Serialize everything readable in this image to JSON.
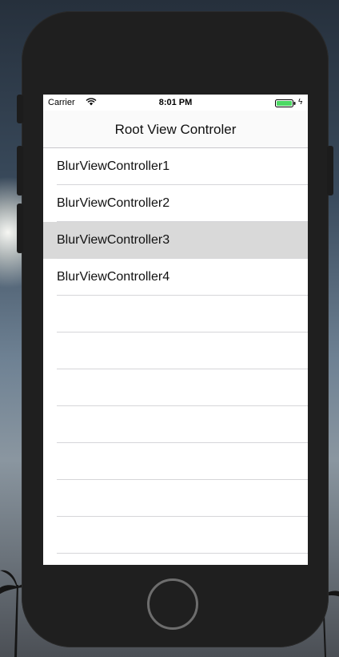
{
  "status_bar": {
    "carrier": "Carrier",
    "time": "8:01 PM",
    "wifi_icon": "wifi-icon",
    "battery_icon": "battery-icon",
    "battery_level": 1.0,
    "battery_color": "#4cd964",
    "charge_icon": "charging-bolt-icon"
  },
  "nav_bar": {
    "title": "Root View Controler"
  },
  "table": {
    "rows": [
      {
        "label": "BlurViewController1",
        "selected": false
      },
      {
        "label": "BlurViewController2",
        "selected": false
      },
      {
        "label": "BlurViewController3",
        "selected": true
      },
      {
        "label": "BlurViewController4",
        "selected": false
      },
      {
        "label": "",
        "selected": false
      },
      {
        "label": "",
        "selected": false
      },
      {
        "label": "",
        "selected": false
      },
      {
        "label": "",
        "selected": false
      },
      {
        "label": "",
        "selected": false
      },
      {
        "label": "",
        "selected": false
      },
      {
        "label": "",
        "selected": false
      }
    ]
  },
  "colors": {
    "selected_row": "#d9d9d9",
    "device_body": "#1f1f1f"
  }
}
